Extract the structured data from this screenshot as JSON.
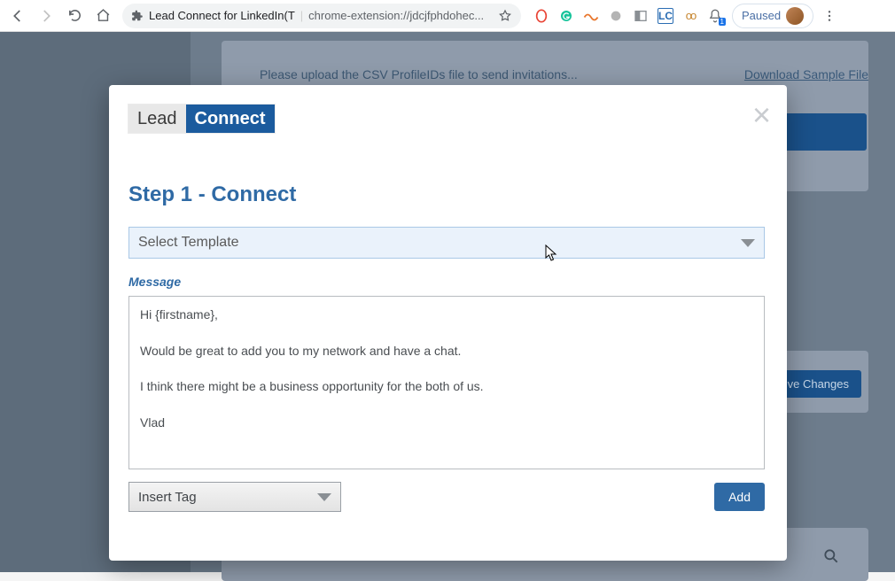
{
  "browser": {
    "tab_title": "Lead Connect for LinkedIn(T",
    "url_display": "chrome-extension://jdcjfphdohec...",
    "profile_status": "Paused",
    "notif_badge": "1"
  },
  "background": {
    "upload_prompt": "Please upload the CSV ProfileIDs file to send invitations...",
    "download_link": "Download Sample File",
    "save_button": "ve Changes"
  },
  "modal": {
    "logo_left": "Lead",
    "logo_right": "Connect",
    "step_title": "Step 1 - Connect",
    "template_select": "Select Template",
    "message_label": "Message",
    "message_body": "Hi {firstname},\n\nWould be great to add you to my network and have a chat.\n\nI think there might be a business opportunity for the both of us.\n\nVlad",
    "insert_tag": "Insert Tag",
    "add_button": "Add"
  }
}
